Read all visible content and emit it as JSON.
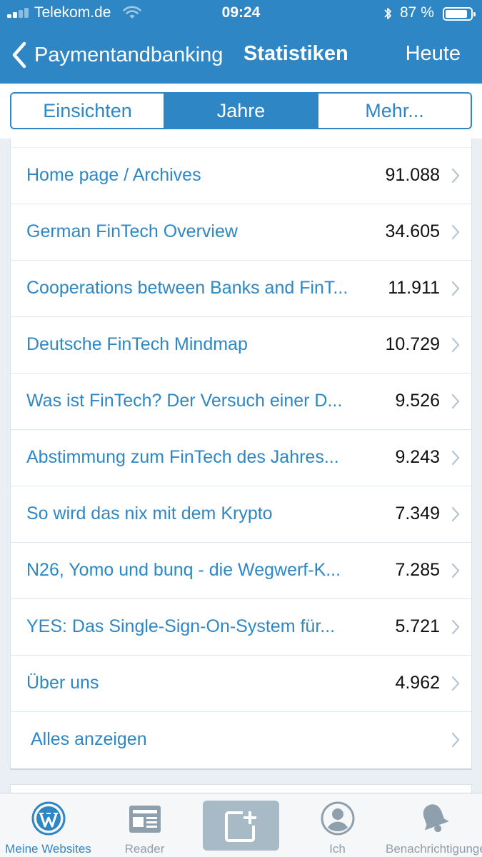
{
  "status_bar": {
    "carrier": "Telekom.de",
    "time": "09:24",
    "battery_percent": "87 %",
    "battery_level": 0.87
  },
  "nav": {
    "back_label": "Paymentandbanking",
    "title": "Statistiken",
    "right_button": "Heute"
  },
  "segments": [
    {
      "label": "Einsichten",
      "active": false
    },
    {
      "label": "Jahre",
      "active": true
    },
    {
      "label": "Mehr...",
      "active": false
    }
  ],
  "list": {
    "rows": [
      {
        "label": "Home page / Archives",
        "value": "91.088"
      },
      {
        "label": "German FinTech Overview",
        "value": "34.605"
      },
      {
        "label": "Cooperations between Banks and FinT...",
        "value": "11.911"
      },
      {
        "label": "Deutsche FinTech Mindmap",
        "value": "10.729"
      },
      {
        "label": "Was ist FinTech? Der Versuch einer D...",
        "value": "9.526"
      },
      {
        "label": "Abstimmung zum FinTech des Jahres...",
        "value": "9.243"
      },
      {
        "label": "So wird das nix mit dem Krypto",
        "value": "7.349"
      },
      {
        "label": "N26, Yomo und bunq - die Wegwerf-K...",
        "value": "7.285"
      },
      {
        "label": "YES: Das Single-Sign-On-System für...",
        "value": "5.721"
      },
      {
        "label": "Über uns",
        "value": "4.962"
      }
    ],
    "show_all_label": "Alles anzeigen"
  },
  "tabbar": {
    "items": [
      {
        "label": "Meine Websites",
        "icon": "wordpress-icon",
        "active": true
      },
      {
        "label": "Reader",
        "icon": "reader-icon",
        "active": false
      },
      {
        "label": "",
        "icon": "new-post-icon",
        "active": false
      },
      {
        "label": "Ich",
        "icon": "profile-icon",
        "active": false
      },
      {
        "label": "Benachrichtigungen",
        "icon": "bell-icon",
        "active": false
      }
    ]
  },
  "colors": {
    "accent": "#2e87c4",
    "background": "#e9eff3",
    "inactive_tab": "#8ea0ad"
  }
}
